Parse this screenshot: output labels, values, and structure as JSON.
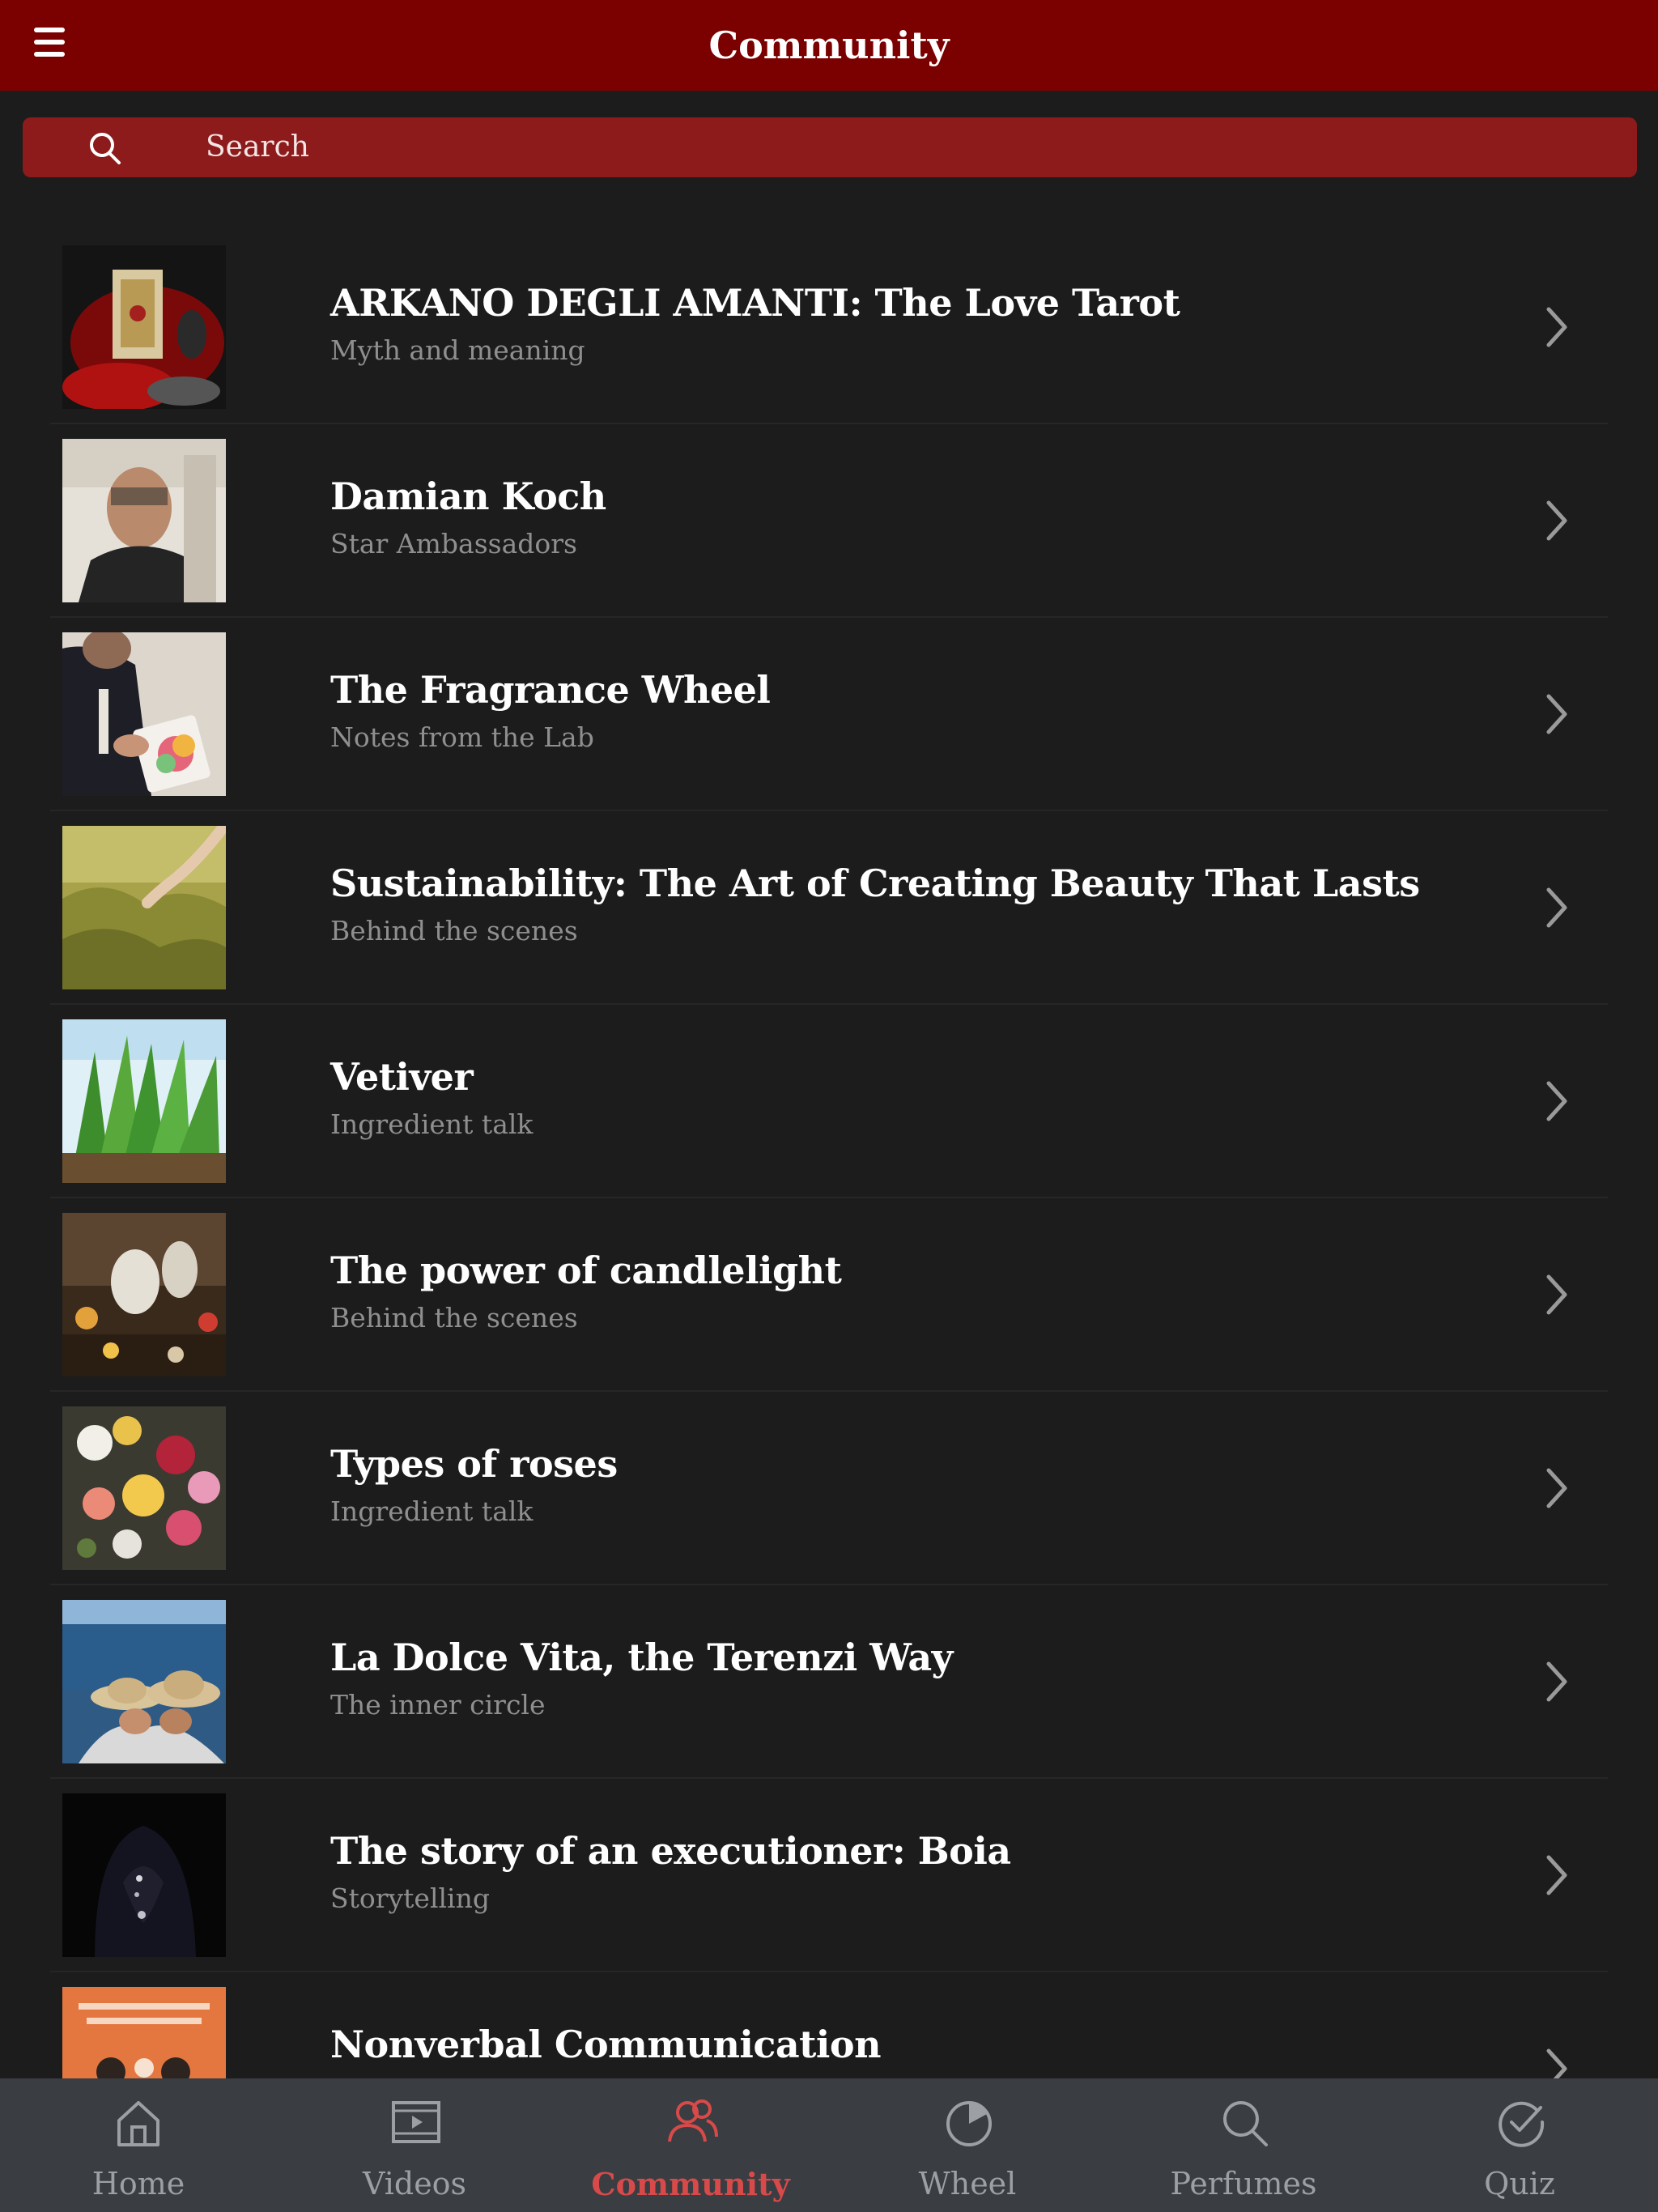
{
  "header": {
    "title": "Community",
    "background": "#7b0000"
  },
  "search": {
    "placeholder": "Search"
  },
  "items": [
    {
      "title": "ARKANO DEGLI AMANTI: The Love Tarot",
      "subtitle": "Myth and meaning"
    },
    {
      "title": "Damian Koch",
      "subtitle": "Star Ambassadors"
    },
    {
      "title": "The Fragrance Wheel",
      "subtitle": "Notes from the Lab"
    },
    {
      "title": "Sustainability: The Art of Creating Beauty That Lasts",
      "subtitle": "Behind the scenes"
    },
    {
      "title": "Vetiver",
      "subtitle": "Ingredient talk"
    },
    {
      "title": "The power of candlelight",
      "subtitle": "Behind the scenes"
    },
    {
      "title": "Types of roses",
      "subtitle": "Ingredient talk"
    },
    {
      "title": "La Dolce Vita, the Terenzi Way",
      "subtitle": "The inner circle"
    },
    {
      "title": "The story of an executioner: Boia",
      "subtitle": "Storytelling"
    },
    {
      "title": "Nonverbal Communication",
      "subtitle": ""
    }
  ],
  "tabs": [
    {
      "label": "Home",
      "icon": "home-icon"
    },
    {
      "label": "Videos",
      "icon": "video-icon"
    },
    {
      "label": "Community",
      "icon": "community-icon",
      "active": true
    },
    {
      "label": "Wheel",
      "icon": "wheel-icon"
    },
    {
      "label": "Perfumes",
      "icon": "search-icon"
    },
    {
      "label": "Quiz",
      "icon": "quiz-icon"
    }
  ],
  "colors": {
    "accent": "#d84a4a",
    "tabbar": "#3a3d42",
    "search_bar": "#8e1b1b",
    "background": "#1c1c1d"
  }
}
